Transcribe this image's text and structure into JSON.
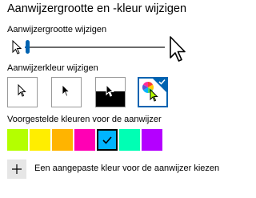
{
  "title": "Aanwijzergrootte en -kleur wijzigen",
  "size_section": {
    "label": "Aanwijzergrootte wijzigen",
    "slider_value_fraction": 0.02,
    "accent_color": "#0063b1"
  },
  "color_section": {
    "label": "Aanwijzerkleur wijzigen",
    "options": [
      {
        "name": "white-cursor",
        "icon": "white-cursor-icon",
        "selected": false
      },
      {
        "name": "black-cursor",
        "icon": "black-cursor-icon",
        "selected": false
      },
      {
        "name": "inverted-cursor",
        "icon": "inverted-cursor-icon",
        "selected": false
      },
      {
        "name": "custom-color-cursor",
        "icon": "color-wheel-cursor-icon",
        "selected": true
      }
    ]
  },
  "suggested_section": {
    "label": "Voorgestelde kleuren voor de aanwijzer",
    "colors": [
      "#b4ff00",
      "#ffee00",
      "#ffb400",
      "#ff00b4",
      "#00b4ff",
      "#00ffb4",
      "#b400ff"
    ],
    "selected_index": 4
  },
  "custom": {
    "label": "Een aangepaste kleur voor de aanwijzer kiezen",
    "icon": "plus-icon"
  }
}
